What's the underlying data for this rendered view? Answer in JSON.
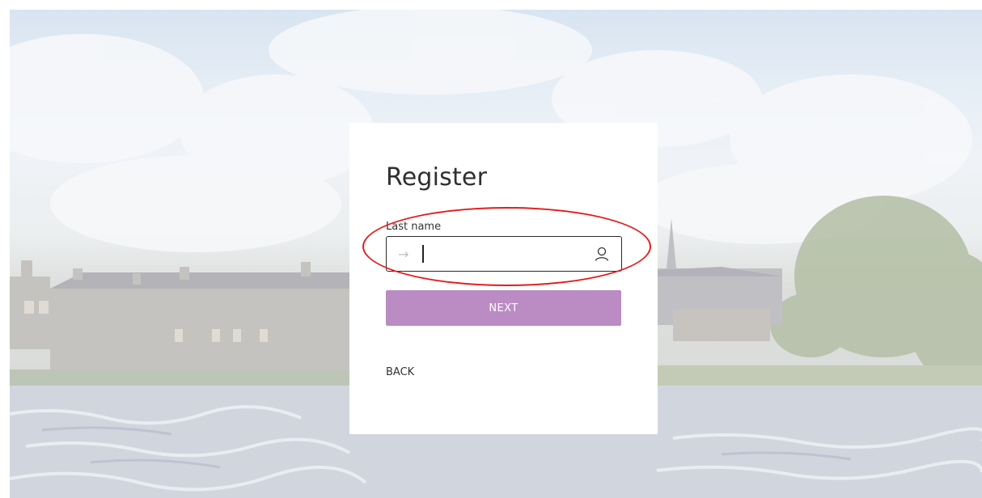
{
  "page": {
    "background_scene": "river-castle-photo-icon"
  },
  "form": {
    "title": "Register",
    "field_label": "Last name",
    "input_value": "",
    "input_placeholder": "",
    "leading_icon": "arrow-right-icon",
    "trailing_icon": "user-icon",
    "next_label": "NEXT",
    "back_label": "BACK"
  },
  "colors": {
    "accent": "#bb8bc4",
    "annotation": "#e41b1b",
    "field_border": "#2a2a2a"
  }
}
